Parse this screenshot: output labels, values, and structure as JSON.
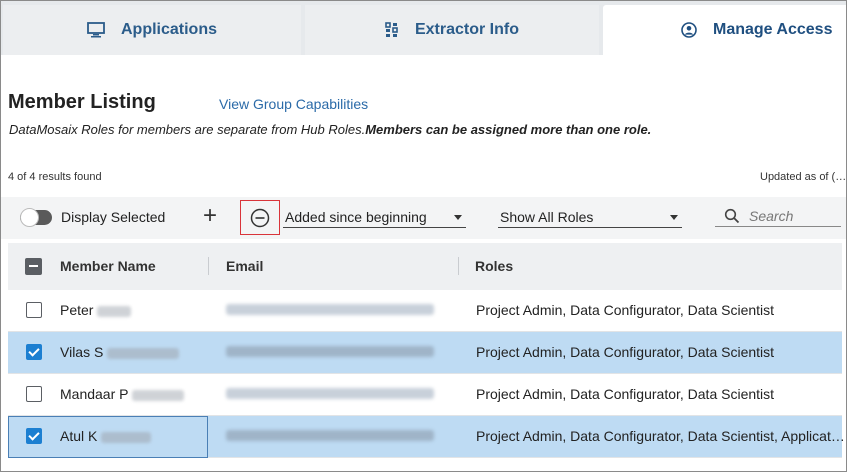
{
  "tabs": [
    {
      "label": "Applications",
      "icon": "monitor-icon"
    },
    {
      "label": "Extractor Info",
      "icon": "extractor-icon"
    },
    {
      "label": "Manage Access",
      "icon": "user-circle-icon",
      "active": true
    }
  ],
  "section": {
    "title": "Member Listing",
    "link": "View Group Capabilities",
    "note_italic": "DataMosaix Roles for members are separate from Hub Roles.",
    "note_bold": "Members can be assigned more than one role.",
    "results": "4 of 4 results found",
    "updated": "Updated as of (…"
  },
  "toolbar": {
    "display_selected": "Display Selected",
    "add_icon": "plus-icon",
    "remove_icon": "minus-circle-icon",
    "filter_date": "Added since beginning",
    "filter_roles": "Show All Roles",
    "search_placeholder": "Search"
  },
  "table": {
    "headers": {
      "name": "Member Name",
      "email": "Email",
      "roles": "Roles"
    },
    "rows": [
      {
        "name": "Peter",
        "email": "peter.quinn@rockwellautomati…",
        "roles": "Project Admin, Data Configurator, Data Scientist",
        "selected": false
      },
      {
        "name": "Vilas S",
        "email": "vilas.dharmasuryawanshi@rock…",
        "roles": "Project Admin, Data Configurator, Data Scientist",
        "selected": true
      },
      {
        "name": "Mandaar P",
        "email": "mandaar.patnarkar@rockwellaut…",
        "roles": "Project Admin, Data Configurator, Data Scientist",
        "selected": false
      },
      {
        "name": "Atul K",
        "email": "atul.kandhari@rockwellautomati…",
        "roles": "Project Admin, Data Configurator, Data Scientist, Applicat…",
        "selected": true
      }
    ]
  },
  "colors": {
    "accent": "#2b5c8a",
    "selected_row": "#bedbf3",
    "checkbox": "#1c7fd1",
    "highlight_border": "#d9343a"
  }
}
